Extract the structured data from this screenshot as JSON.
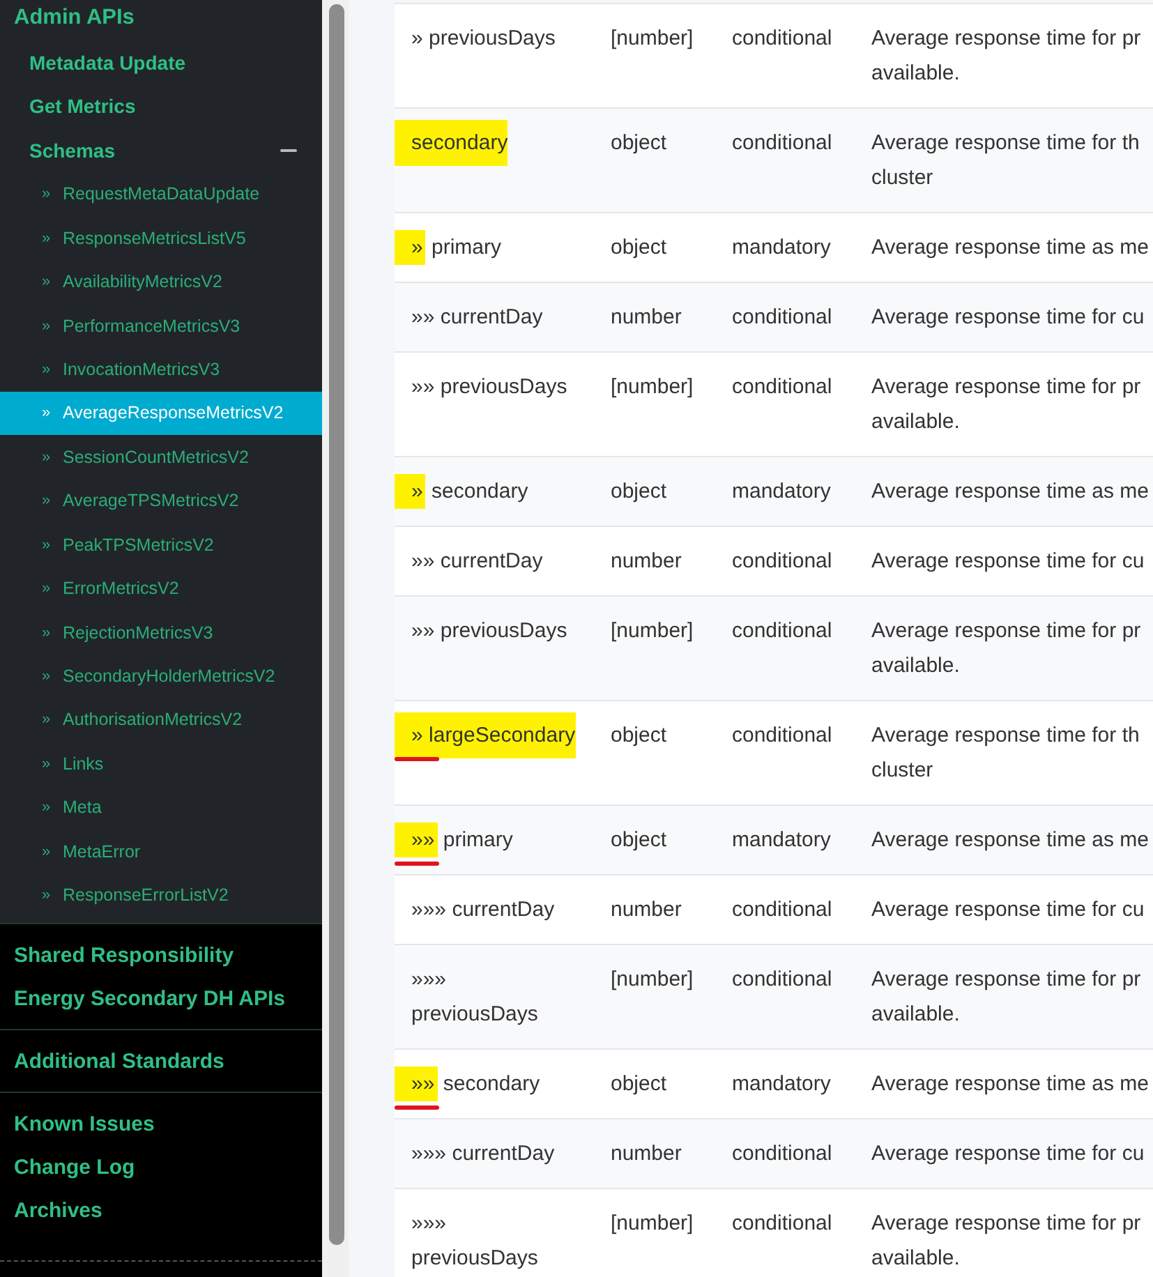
{
  "sidebar": {
    "heading": "Admin APIs",
    "items": [
      {
        "label": "Metadata Update"
      },
      {
        "label": "Get Metrics"
      },
      {
        "label": "Schemas",
        "expanded": true,
        "children": [
          {
            "marker": "»",
            "label": "RequestMetaDataUpdate",
            "selected": false
          },
          {
            "marker": "»",
            "label": "ResponseMetricsListV5",
            "selected": false
          },
          {
            "marker": "»",
            "label": "AvailabilityMetricsV2",
            "selected": false
          },
          {
            "marker": "»",
            "label": "PerformanceMetricsV3",
            "selected": false
          },
          {
            "marker": "»",
            "label": "InvocationMetricsV3",
            "selected": false
          },
          {
            "marker": "»",
            "label": "AverageResponseMetricsV2",
            "selected": true
          },
          {
            "marker": "»",
            "label": "SessionCountMetricsV2",
            "selected": false
          },
          {
            "marker": "»",
            "label": "AverageTPSMetricsV2",
            "selected": false
          },
          {
            "marker": "»",
            "label": "PeakTPSMetricsV2",
            "selected": false
          },
          {
            "marker": "»",
            "label": "ErrorMetricsV2",
            "selected": false
          },
          {
            "marker": "»",
            "label": "RejectionMetricsV3",
            "selected": false
          },
          {
            "marker": "»",
            "label": "SecondaryHolderMetricsV2",
            "selected": false
          },
          {
            "marker": "»",
            "label": "AuthorisationMetricsV2",
            "selected": false
          },
          {
            "marker": "»",
            "label": "Links",
            "selected": false
          },
          {
            "marker": "»",
            "label": "Meta",
            "selected": false
          },
          {
            "marker": "»",
            "label": "MetaError",
            "selected": false
          },
          {
            "marker": "»",
            "label": "ResponseErrorListV2",
            "selected": false
          }
        ]
      }
    ],
    "groups": [
      {
        "links": [
          "Shared Responsibility",
          "Energy Secondary DH APIs"
        ]
      },
      {
        "links": [
          "Additional Standards"
        ]
      },
      {
        "links": [
          "Known Issues",
          "Change Log",
          "Archives"
        ]
      }
    ]
  },
  "table": {
    "rows": [
      {
        "prefix": "»",
        "name": "previousDays",
        "type": "[number]",
        "requirement": "conditional",
        "description": [
          "Average response time for pr",
          "available."
        ],
        "name_highlighted": false,
        "prefix_highlighted": false,
        "underlined": false
      },
      {
        "name": "secondary",
        "type": "object",
        "requirement": "conditional",
        "description": [
          "Average response time for th",
          "cluster"
        ],
        "name_highlighted": true,
        "prefix_highlighted": false,
        "underlined": false
      },
      {
        "prefix": "»",
        "name": "primary",
        "type": "object",
        "requirement": "mandatory",
        "description": [
          "Average response time as me"
        ],
        "name_highlighted": false,
        "prefix_highlighted": true,
        "underlined": false
      },
      {
        "prefix": "»»",
        "name": "currentDay",
        "type": "number",
        "requirement": "conditional",
        "description": [
          "Average response time for cu"
        ],
        "name_highlighted": false,
        "prefix_highlighted": false,
        "underlined": false
      },
      {
        "prefix": "»»",
        "name": "previousDays",
        "type": "[number]",
        "requirement": "conditional",
        "description": [
          "Average response time for pr",
          "available."
        ],
        "name_highlighted": false,
        "prefix_highlighted": false,
        "underlined": false
      },
      {
        "prefix": "»",
        "name": "secondary",
        "type": "object",
        "requirement": "mandatory",
        "description": [
          "Average response time as me"
        ],
        "name_highlighted": false,
        "prefix_highlighted": true,
        "underlined": false
      },
      {
        "prefix": "»»",
        "name": "currentDay",
        "type": "number",
        "requirement": "conditional",
        "description": [
          "Average response time for cu"
        ],
        "name_highlighted": false,
        "prefix_highlighted": false,
        "underlined": false
      },
      {
        "prefix": "»»",
        "name": "previousDays",
        "type": "[number]",
        "requirement": "conditional",
        "description": [
          "Average response time for pr",
          "available."
        ],
        "name_highlighted": false,
        "prefix_highlighted": false,
        "underlined": false
      },
      {
        "prefix": "»",
        "name": "largeSecondary",
        "type": "object",
        "requirement": "conditional",
        "description": [
          "Average response time for th",
          "cluster"
        ],
        "name_highlighted": true,
        "prefix_highlighted": false,
        "underlined": true
      },
      {
        "prefix": "»»",
        "name": "primary",
        "type": "object",
        "requirement": "mandatory",
        "description": [
          "Average response time as me"
        ],
        "name_highlighted": false,
        "prefix_highlighted": true,
        "underlined": true
      },
      {
        "prefix": "»»»",
        "name": "currentDay",
        "type": "number",
        "requirement": "conditional",
        "description": [
          "Average response time for cu"
        ],
        "name_highlighted": false,
        "prefix_highlighted": false,
        "underlined": false
      },
      {
        "prefix": "»»»",
        "name": "previousDays",
        "type": "[number]",
        "requirement": "conditional",
        "description": [
          "Average response time for pr",
          "available."
        ],
        "name_highlighted": false,
        "prefix_highlighted": false,
        "underlined": false
      },
      {
        "prefix": "»»",
        "name": "secondary",
        "type": "object",
        "requirement": "mandatory",
        "description": [
          "Average response time as me"
        ],
        "name_highlighted": false,
        "prefix_highlighted": true,
        "underlined": true
      },
      {
        "prefix": "»»»",
        "name": "currentDay",
        "type": "number",
        "requirement": "conditional",
        "description": [
          "Average response time for cu"
        ],
        "name_highlighted": false,
        "prefix_highlighted": false,
        "underlined": false
      },
      {
        "prefix": "»»»",
        "name": "previousDays",
        "type": "[number]",
        "requirement": "conditional",
        "description": [
          "Average response time for pr",
          "available."
        ],
        "name_highlighted": false,
        "prefix_highlighted": false,
        "underlined": false
      }
    ]
  }
}
